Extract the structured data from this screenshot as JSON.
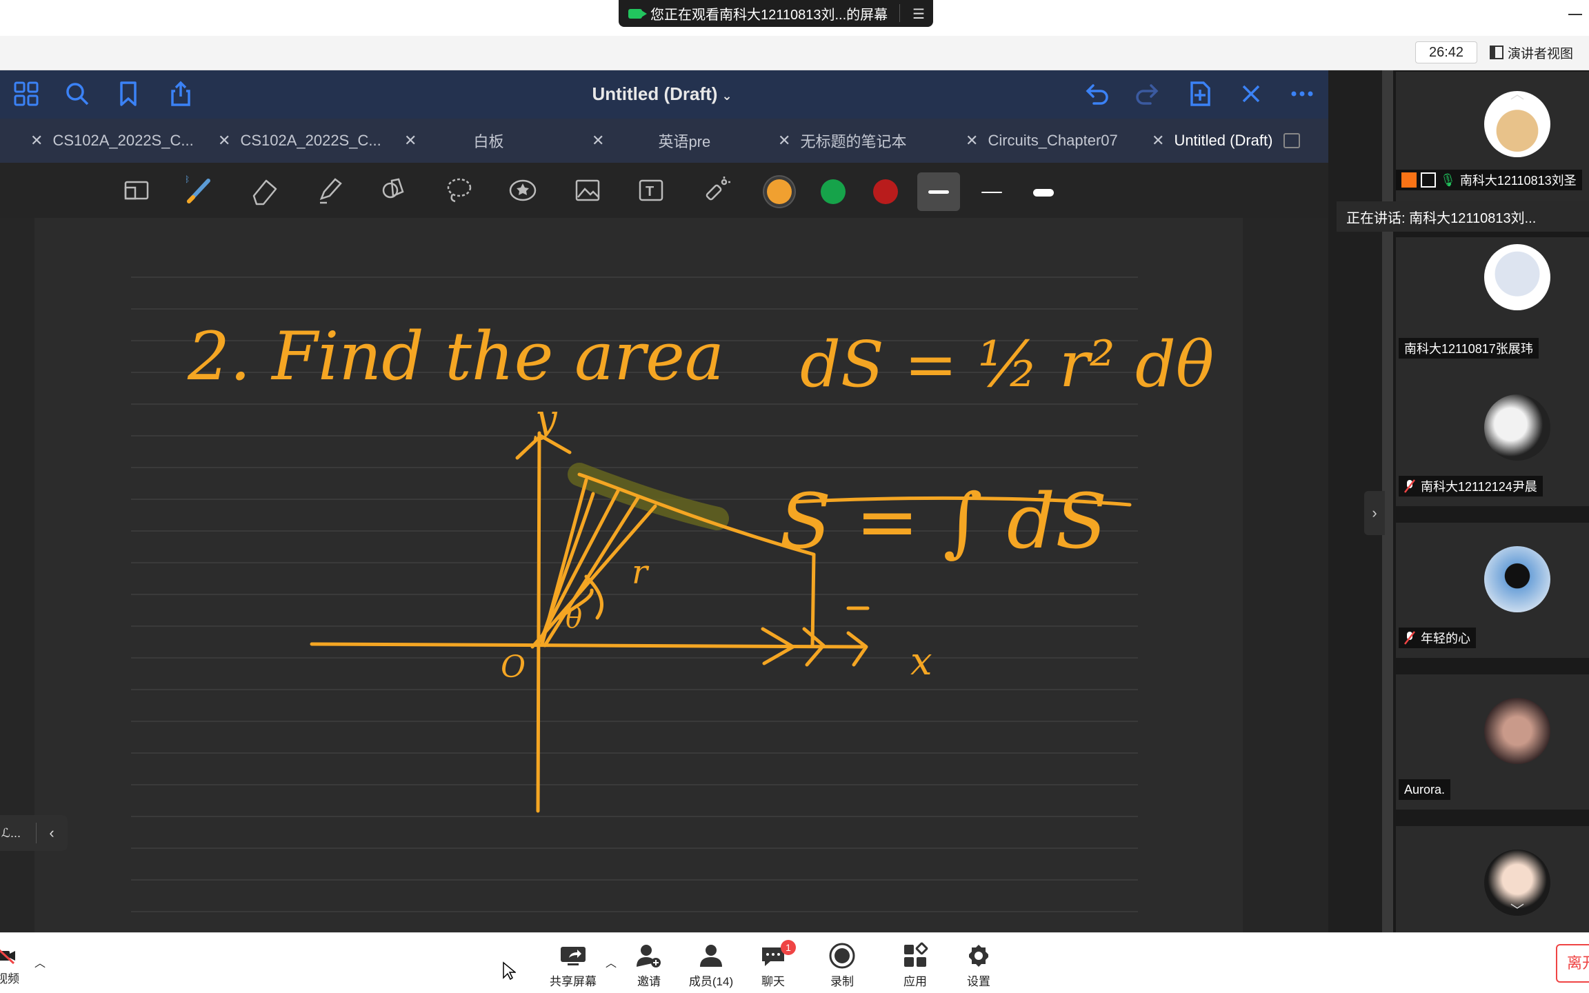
{
  "meeting": {
    "share_banner": "您正在观看南科大12110813刘...的屏幕",
    "timer": "26:42",
    "presenter_view": "演讲者视图"
  },
  "app": {
    "title": "Untitled (Draft)",
    "tabs": [
      {
        "label": "CS102A_2022S_C...",
        "active": false
      },
      {
        "label": "CS102A_2022S_C...",
        "active": false
      },
      {
        "label": "白板",
        "active": false
      },
      {
        "label": "英语pre",
        "active": false
      },
      {
        "label": "无标题的笔记本",
        "active": false
      },
      {
        "label": "Circuits_Chapter07",
        "active": false
      },
      {
        "label": "Untitled (Draft)",
        "active": true
      }
    ],
    "pen_colors": [
      "#f0a030",
      "#16a34a",
      "#b91c1c"
    ],
    "ink_color": "#f5a623",
    "left_pill": "ℒ..."
  },
  "whiteboard": {
    "heading": "2. Find the area",
    "formula_1": "dS = ½ r² dθ",
    "formula_2": "S = ∫ dS",
    "axis_y": "y",
    "axis_x": "x",
    "origin": "O",
    "radius_label": "r",
    "angle_label": "θ"
  },
  "gallery": {
    "speaking": "正在讲话: 南科大12110813刘...",
    "participants": [
      {
        "name": "南科大12110813刘圣",
        "mic": "on"
      },
      {
        "name": "南科大12110817张展玮",
        "mic": "none"
      },
      {
        "name": "南科大12112124尹晨",
        "mic": "muted"
      },
      {
        "name": "年轻的心",
        "mic": "muted"
      },
      {
        "name": "Aurora.",
        "mic": "none"
      },
      {
        "name": "",
        "mic": "none"
      }
    ]
  },
  "bottom": {
    "video": "视频",
    "share": "共享屏幕",
    "invite": "邀请",
    "members": "成员(14)",
    "chat": "聊天",
    "chat_badge": "1",
    "record": "录制",
    "apps": "应用",
    "settings": "设置",
    "leave": "离开"
  }
}
